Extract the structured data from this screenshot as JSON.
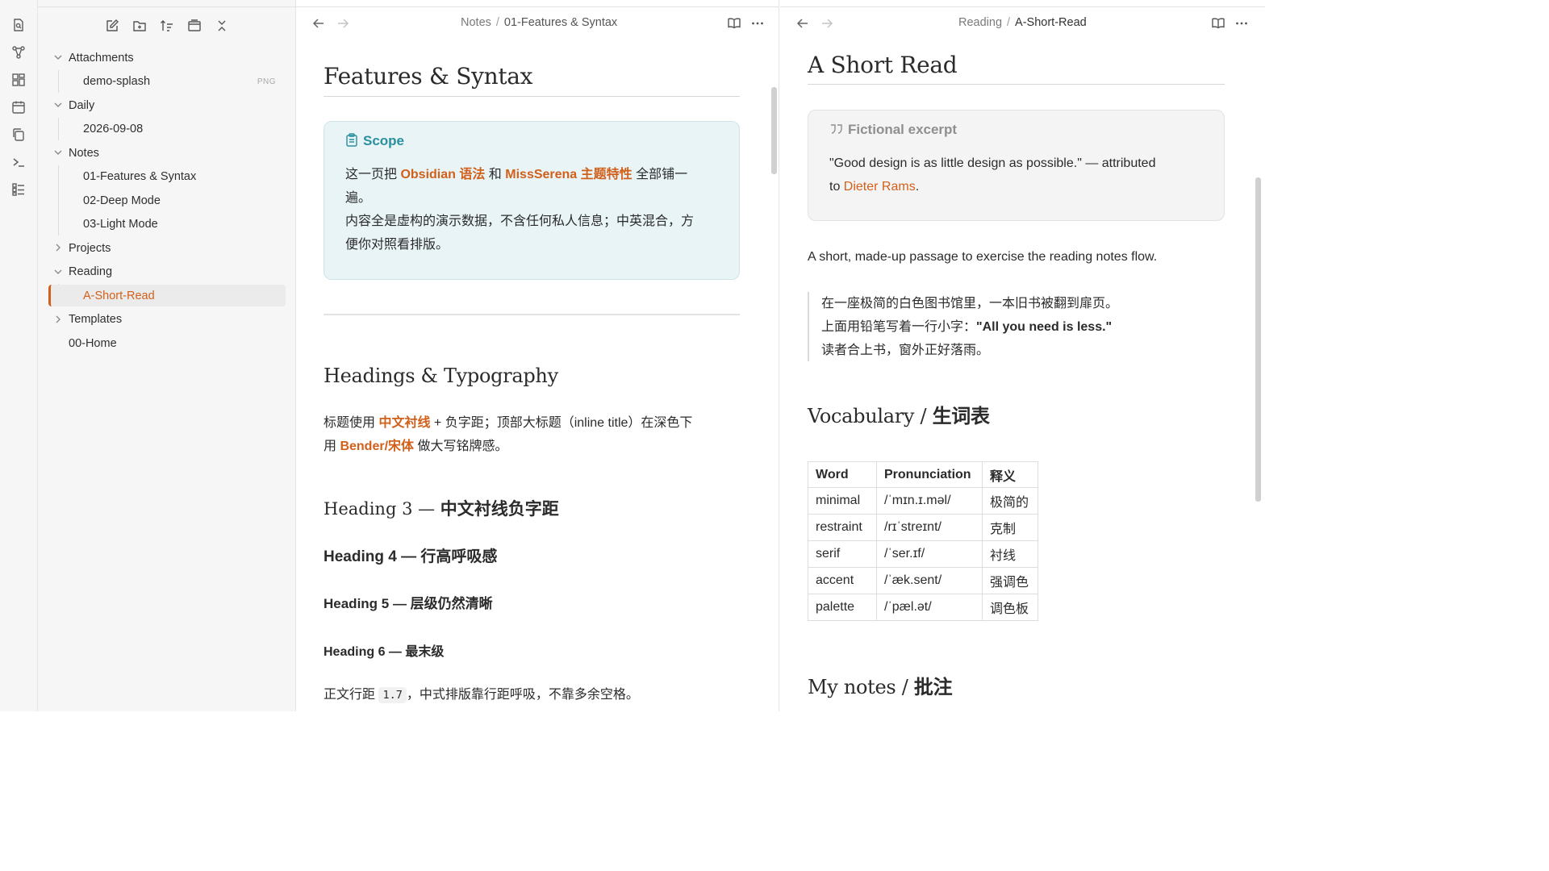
{
  "sidebar": {
    "tree": [
      {
        "label": "Attachments",
        "kind": "folder",
        "expanded": true
      },
      {
        "label": "demo-splash",
        "kind": "file",
        "ext": "PNG"
      },
      {
        "label": "Daily",
        "kind": "folder",
        "expanded": true
      },
      {
        "label": "2026-09-08",
        "kind": "file"
      },
      {
        "label": "Notes",
        "kind": "folder",
        "expanded": true
      },
      {
        "label": "01-Features & Syntax",
        "kind": "file"
      },
      {
        "label": "02-Deep Mode",
        "kind": "file"
      },
      {
        "label": "03-Light Mode",
        "kind": "file"
      },
      {
        "label": "Projects",
        "kind": "folder",
        "expanded": false
      },
      {
        "label": "Reading",
        "kind": "folder",
        "expanded": true
      },
      {
        "label": "A-Short-Read",
        "kind": "file",
        "active": true
      },
      {
        "label": "Templates",
        "kind": "folder",
        "expanded": false
      },
      {
        "label": "00-Home",
        "kind": "file"
      }
    ]
  },
  "left_pane": {
    "breadcrumb": [
      "Notes",
      "01-Features & Syntax"
    ],
    "title": "Features & Syntax",
    "callout": {
      "title": "Scope",
      "l1_a": "这一页把 ",
      "l1_b": "Obsidian 语法",
      "l1_c": " 和 ",
      "l1_d": "MissSerena 主题特性",
      "l1_e": " 全部铺一",
      "l2": "遍。",
      "l3": "内容全是虚构的演示数据，不含任何私人信息；中英混合，方",
      "l4": "便你对照看排版。"
    },
    "h2_typography": "Headings & Typography",
    "typo_p1_a": "标题使用 ",
    "typo_p1_b": "中文衬线",
    "typo_p1_c": " + 负字距；顶部大标题（inline title）在深色下",
    "typo_p2_a": "用 ",
    "typo_p2_b": "Bender/宋体",
    "typo_p2_c": " 做大写铭牌感。",
    "h3_a": "Heading 3 — ",
    "h3_b": "中文衬线负字距",
    "h4": "Heading 4 — 行高呼吸感",
    "h5": "Heading 5 — 层级仍然清晰",
    "h6": "Heading 6 — 最末级",
    "body_a": "正文行距 ",
    "body_code": "1.7",
    "body_b": "，中式排版靠行距呼吸，不靠多余空格。"
  },
  "right_pane": {
    "breadcrumb": [
      "Reading",
      "A-Short-Read"
    ],
    "title": "A Short Read",
    "quote_callout": {
      "title": "Fictional excerpt",
      "l1": "\"Good design is as little design as possible.\" — attributed",
      "l2_a": "to ",
      "l2_b": "Dieter Rams",
      "l2_c": "."
    },
    "intro": "A short, made-up passage to exercise the reading notes flow.",
    "blockquote": {
      "l1": "在一座极简的白色图书馆里，一本旧书被翻到扉页。",
      "l2_a": "上面用铅笔写着一行小字：",
      "l2_b": "\"All you need is less.\"",
      "l3": "读者合上书，窗外正好落雨。"
    },
    "h2_vocab_a": "Vocabulary / ",
    "h2_vocab_b": "生词表",
    "vocab_headers": [
      "Word",
      "Pronunciation",
      "释义"
    ],
    "vocab_rows": [
      [
        "minimal",
        "/ˈmɪn.ɪ.məl/",
        "极简的"
      ],
      [
        "restraint",
        "/rɪˈstreɪnt/",
        "克制"
      ],
      [
        "serif",
        "/ˈser.ɪf/",
        "衬线"
      ],
      [
        "accent",
        "/ˈæk.sent/",
        "强调色"
      ],
      [
        "palette",
        "/ˈpæl.ət/",
        "调色板"
      ]
    ],
    "h2_notes_a": "My notes / ",
    "h2_notes_b": "批注"
  },
  "colors": {
    "accent": "#d2601a",
    "callout_bg": "#e8f4f6",
    "callout_title": "#2a8fa0",
    "sidebar_bg": "#f6f6f6"
  }
}
